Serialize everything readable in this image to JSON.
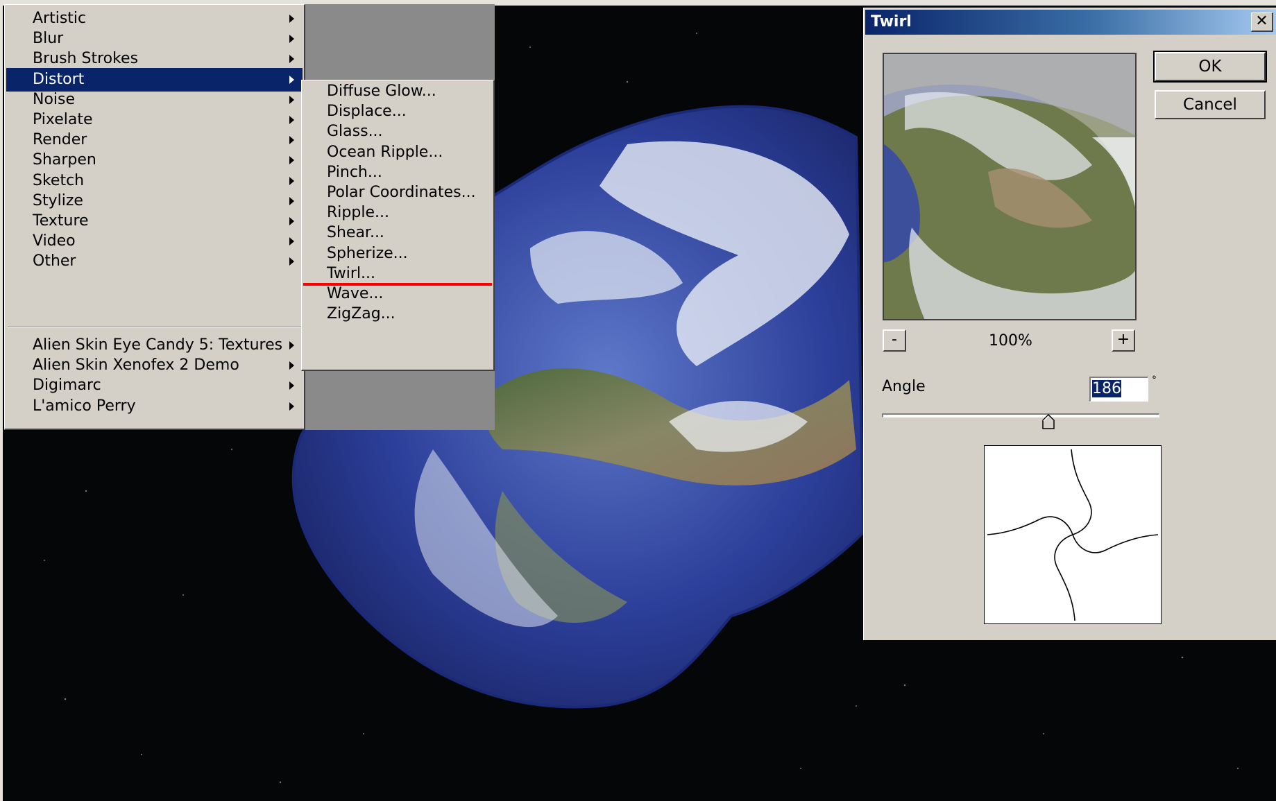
{
  "menu": {
    "items": [
      {
        "label": "Artistic"
      },
      {
        "label": "Blur"
      },
      {
        "label": "Brush Strokes"
      },
      {
        "label": "Distort",
        "active": true
      },
      {
        "label": "Noise"
      },
      {
        "label": "Pixelate"
      },
      {
        "label": "Render"
      },
      {
        "label": "Sharpen"
      },
      {
        "label": "Sketch"
      },
      {
        "label": "Stylize"
      },
      {
        "label": "Texture"
      },
      {
        "label": "Video"
      },
      {
        "label": "Other"
      }
    ],
    "plugins": [
      {
        "label": "Alien Skin Eye Candy 5: Textures"
      },
      {
        "label": "Alien Skin Xenofex 2 Demo"
      },
      {
        "label": "Digimarc"
      },
      {
        "label": "L'amico Perry"
      }
    ]
  },
  "submenu": {
    "items": [
      {
        "label": "Diffuse Glow..."
      },
      {
        "label": "Displace..."
      },
      {
        "label": "Glass..."
      },
      {
        "label": "Ocean Ripple..."
      },
      {
        "label": "Pinch..."
      },
      {
        "label": "Polar Coordinates..."
      },
      {
        "label": "Ripple..."
      },
      {
        "label": "Shear..."
      },
      {
        "label": "Spherize..."
      },
      {
        "label": "Twirl...",
        "highlight_color": "#ff0000"
      },
      {
        "label": "Wave..."
      },
      {
        "label": "ZigZag..."
      }
    ]
  },
  "dialog": {
    "title": "Twirl",
    "close_label": "✕",
    "ok_label": "OK",
    "cancel_label": "Cancel",
    "zoom_out_label": "-",
    "zoom_in_label": "+",
    "zoom_level": "100%",
    "angle_label": "Angle",
    "angle_value": "186",
    "degree_symbol": "°",
    "slider_fraction": 0.6
  },
  "colors": {
    "menu_bg": "#d4d0c8",
    "selection": "#0a246a",
    "space": "#050607",
    "earth_ocean": "#2c3f9a",
    "annotation": "#ff0000"
  },
  "icons": {
    "submenu_arrow": "submenu-arrow-icon",
    "close": "close-icon",
    "slider_thumb": "slider-thumb-icon"
  }
}
